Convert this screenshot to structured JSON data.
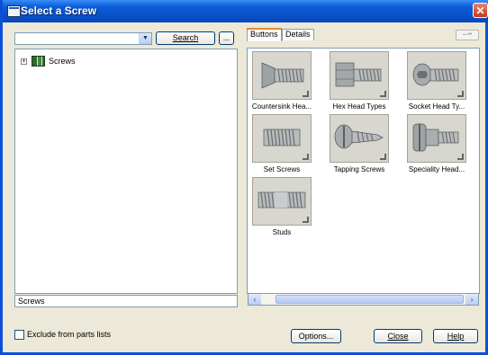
{
  "window": {
    "title": "Select a Screw"
  },
  "search": {
    "combo_value": "",
    "search_label": "Search",
    "browse_label": "..."
  },
  "tree": {
    "items": [
      {
        "label": "Screws",
        "expanded": false,
        "icon": "library-book-icon"
      }
    ]
  },
  "status": {
    "text": "Screws"
  },
  "tabs": [
    {
      "label": "Buttons",
      "active": true
    },
    {
      "label": "Details",
      "active": false
    }
  ],
  "view_toggle_label": "⭠••",
  "gallery": {
    "items": [
      {
        "label": "Countersink Hea...",
        "kind": "countersink"
      },
      {
        "label": "Hex Head Types",
        "kind": "hex"
      },
      {
        "label": "Socket Head Ty...",
        "kind": "socket"
      },
      {
        "label": "Set Screws",
        "kind": "set"
      },
      {
        "label": "Tapping Screws",
        "kind": "tapping"
      },
      {
        "label": "Speciality Head...",
        "kind": "speciality"
      },
      {
        "label": "Studs",
        "kind": "stud"
      }
    ]
  },
  "checkbox": {
    "label": "Exclude from parts lists",
    "checked": false
  },
  "buttons": {
    "options": "Options...",
    "close": "Close",
    "help": "Help"
  },
  "colors": {
    "titlebar": "#0b5ed8",
    "face": "#ece9d8",
    "accent_tab": "#e68b2c"
  }
}
